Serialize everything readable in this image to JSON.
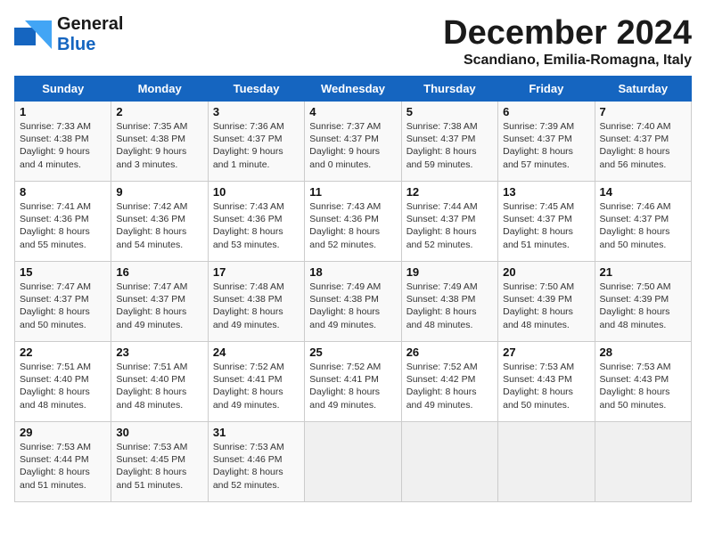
{
  "logo": {
    "general": "General",
    "blue": "Blue"
  },
  "title": "December 2024",
  "location": "Scandiano, Emilia-Romagna, Italy",
  "days_of_week": [
    "Sunday",
    "Monday",
    "Tuesday",
    "Wednesday",
    "Thursday",
    "Friday",
    "Saturday"
  ],
  "weeks": [
    [
      {
        "day": 1,
        "sunrise": "7:33 AM",
        "sunset": "4:38 PM",
        "daylight": "9 hours and 4 minutes."
      },
      {
        "day": 2,
        "sunrise": "7:35 AM",
        "sunset": "4:38 PM",
        "daylight": "9 hours and 3 minutes."
      },
      {
        "day": 3,
        "sunrise": "7:36 AM",
        "sunset": "4:37 PM",
        "daylight": "9 hours and 1 minute."
      },
      {
        "day": 4,
        "sunrise": "7:37 AM",
        "sunset": "4:37 PM",
        "daylight": "9 hours and 0 minutes."
      },
      {
        "day": 5,
        "sunrise": "7:38 AM",
        "sunset": "4:37 PM",
        "daylight": "8 hours and 59 minutes."
      },
      {
        "day": 6,
        "sunrise": "7:39 AM",
        "sunset": "4:37 PM",
        "daylight": "8 hours and 57 minutes."
      },
      {
        "day": 7,
        "sunrise": "7:40 AM",
        "sunset": "4:37 PM",
        "daylight": "8 hours and 56 minutes."
      }
    ],
    [
      {
        "day": 8,
        "sunrise": "7:41 AM",
        "sunset": "4:36 PM",
        "daylight": "8 hours and 55 minutes."
      },
      {
        "day": 9,
        "sunrise": "7:42 AM",
        "sunset": "4:36 PM",
        "daylight": "8 hours and 54 minutes."
      },
      {
        "day": 10,
        "sunrise": "7:43 AM",
        "sunset": "4:36 PM",
        "daylight": "8 hours and 53 minutes."
      },
      {
        "day": 11,
        "sunrise": "7:43 AM",
        "sunset": "4:36 PM",
        "daylight": "8 hours and 52 minutes."
      },
      {
        "day": 12,
        "sunrise": "7:44 AM",
        "sunset": "4:37 PM",
        "daylight": "8 hours and 52 minutes."
      },
      {
        "day": 13,
        "sunrise": "7:45 AM",
        "sunset": "4:37 PM",
        "daylight": "8 hours and 51 minutes."
      },
      {
        "day": 14,
        "sunrise": "7:46 AM",
        "sunset": "4:37 PM",
        "daylight": "8 hours and 50 minutes."
      }
    ],
    [
      {
        "day": 15,
        "sunrise": "7:47 AM",
        "sunset": "4:37 PM",
        "daylight": "8 hours and 50 minutes."
      },
      {
        "day": 16,
        "sunrise": "7:47 AM",
        "sunset": "4:37 PM",
        "daylight": "8 hours and 49 minutes."
      },
      {
        "day": 17,
        "sunrise": "7:48 AM",
        "sunset": "4:38 PM",
        "daylight": "8 hours and 49 minutes."
      },
      {
        "day": 18,
        "sunrise": "7:49 AM",
        "sunset": "4:38 PM",
        "daylight": "8 hours and 49 minutes."
      },
      {
        "day": 19,
        "sunrise": "7:49 AM",
        "sunset": "4:38 PM",
        "daylight": "8 hours and 48 minutes."
      },
      {
        "day": 20,
        "sunrise": "7:50 AM",
        "sunset": "4:39 PM",
        "daylight": "8 hours and 48 minutes."
      },
      {
        "day": 21,
        "sunrise": "7:50 AM",
        "sunset": "4:39 PM",
        "daylight": "8 hours and 48 minutes."
      }
    ],
    [
      {
        "day": 22,
        "sunrise": "7:51 AM",
        "sunset": "4:40 PM",
        "daylight": "8 hours and 48 minutes."
      },
      {
        "day": 23,
        "sunrise": "7:51 AM",
        "sunset": "4:40 PM",
        "daylight": "8 hours and 48 minutes."
      },
      {
        "day": 24,
        "sunrise": "7:52 AM",
        "sunset": "4:41 PM",
        "daylight": "8 hours and 49 minutes."
      },
      {
        "day": 25,
        "sunrise": "7:52 AM",
        "sunset": "4:41 PM",
        "daylight": "8 hours and 49 minutes."
      },
      {
        "day": 26,
        "sunrise": "7:52 AM",
        "sunset": "4:42 PM",
        "daylight": "8 hours and 49 minutes."
      },
      {
        "day": 27,
        "sunrise": "7:53 AM",
        "sunset": "4:43 PM",
        "daylight": "8 hours and 50 minutes."
      },
      {
        "day": 28,
        "sunrise": "7:53 AM",
        "sunset": "4:43 PM",
        "daylight": "8 hours and 50 minutes."
      }
    ],
    [
      {
        "day": 29,
        "sunrise": "7:53 AM",
        "sunset": "4:44 PM",
        "daylight": "8 hours and 51 minutes."
      },
      {
        "day": 30,
        "sunrise": "7:53 AM",
        "sunset": "4:45 PM",
        "daylight": "8 hours and 51 minutes."
      },
      {
        "day": 31,
        "sunrise": "7:53 AM",
        "sunset": "4:46 PM",
        "daylight": "8 hours and 52 minutes."
      },
      null,
      null,
      null,
      null
    ]
  ]
}
